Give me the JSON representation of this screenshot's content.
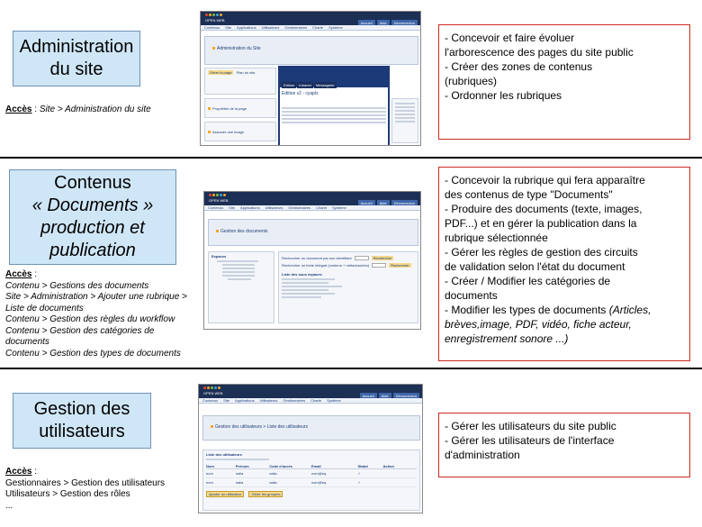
{
  "sections": [
    {
      "title_lines": [
        "Administration",
        "du site"
      ],
      "acces_label": "Accès",
      "acces_sep": " : ",
      "acces_lines": [
        "Site > Administration du site"
      ],
      "desc_lines": [
        "- Concevoir et faire évoluer",
        "l'arborescence des pages du site public",
        "- Créer des zones de contenus",
        "(rubriques)",
        "- Ordonner les rubriques"
      ],
      "shot": {
        "panel_title": "Administration du Site",
        "tab_a": "Gérer la page",
        "tab_b": "Plan du site",
        "side_1": "Propriétés de la page",
        "side_2": "Associer une image",
        "window_tabs": [
          "Edition",
          "Intranet",
          "Messagerie"
        ],
        "window_title": "Edition v2 - cyaplx"
      }
    },
    {
      "title_lines": [
        "Contenus",
        "« Documents »",
        "production et",
        "publication"
      ],
      "acces_label": "Accès",
      "acces_sep": " :",
      "acces_lines": [
        "Contenu > Gestions des documents",
        "Site > Administration > Ajouter une rubrique >",
        "Liste de documents",
        "Contenu > Gestion des règles du workflow",
        "Contenu > Gestion des catégories de",
        "documents",
        "Contenu > Gestion des types de documents"
      ],
      "desc_lines": [
        "- Concevoir la rubrique qui fera apparaître",
        "des contenus de type \"Documents\"",
        "- Produire des documents (texte, images,",
        "PDF...) et en gérer la publication dans la",
        "rubrique sélectionnée",
        "- Gérer les règles de gestion des circuits",
        "de validation selon l'état du document",
        "- Créer / Modifier les catégories de",
        "documents"
      ],
      "desc_tail_main": "- Modifier les types de documents ",
      "desc_tail_italic": "(Articles, brèves,image, PDF, vidéo, fiche acteur, enregistrement sonore ...)",
      "shot": {
        "panel_title": "Gestion des documents",
        "left_title": "Espaces",
        "right_line_1": "Rechercher un document par son identifiant",
        "right_line_2": "Rechercher un texte intégral (contenu + métadonnées)",
        "search_btn": "Rechercher",
        "list_title": "Liste des sous espaces"
      }
    },
    {
      "title_lines": [
        "Gestion des",
        "utilisateurs"
      ],
      "acces_label": "Accès",
      "acces_sep": " :",
      "acces_lines": [
        "Gestionnaires  > Gestion des utilisateurs",
        "Utilisateurs > Gestion des rôles",
        "..."
      ],
      "desc_lines": [
        "- Gérer les utilisateurs du site public",
        "- Gérer les utilisateurs de l'interface",
        "d'administration"
      ],
      "shot": {
        "panel_title": "Gestion des utilisateurs > Liste des utilisateurs",
        "list_title": "Liste des utilisateurs",
        "columns": [
          "Nom",
          "Prénom",
          "Code d'accès",
          "Email",
          "Statut",
          "Action"
        ],
        "rows": [
          [
            "nom",
            "nalia",
            "nalia",
            "nom@eq",
            "✓",
            ""
          ],
          [
            "nom",
            "nalia",
            "nalia",
            "nom@eq",
            "✓",
            ""
          ]
        ],
        "btn_add": "Ajouter un utilisateur",
        "btn_group": "Gérer les groupes"
      }
    }
  ],
  "mini_menu": [
    "Contenus",
    "Site",
    "Applications",
    "Utilisateurs",
    "Gestionnaires",
    "Charte",
    "Système"
  ],
  "mini_tabs": [
    "Accueil",
    "Aide",
    "Déconnexion"
  ],
  "logo_text": "OPEN WEB",
  "logo_colors": [
    "#e8452c",
    "#f6a623",
    "#7fbf3b",
    "#3aa3e0",
    "#f6a623"
  ]
}
